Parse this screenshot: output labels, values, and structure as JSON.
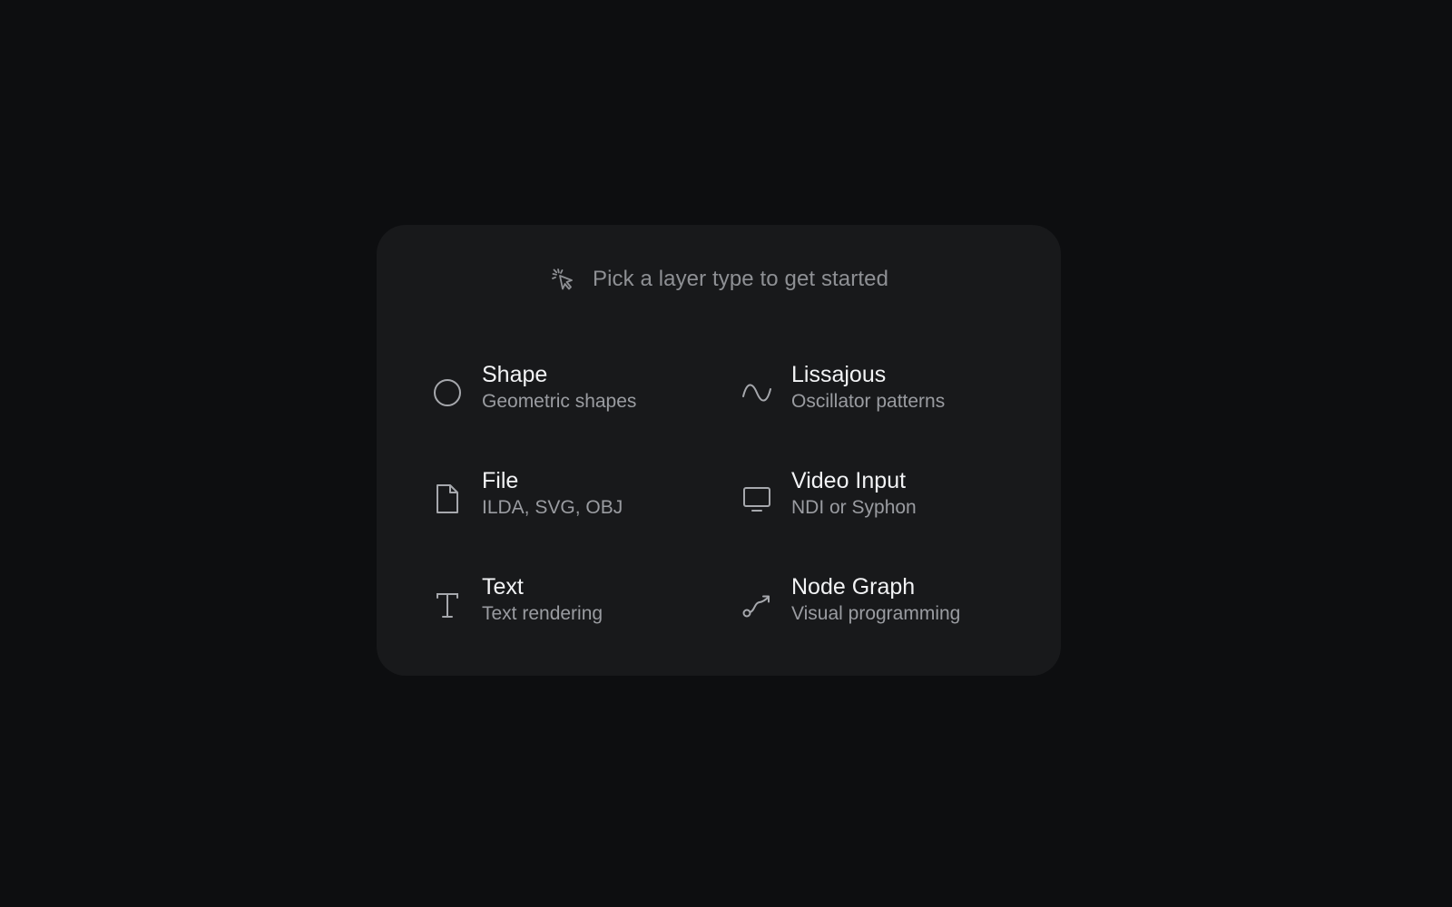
{
  "prompt": {
    "icon": "pointer-click-icon",
    "text": "Pick a layer type to get started"
  },
  "layer_types": [
    {
      "icon": "circle-icon",
      "title": "Shape",
      "subtitle": "Geometric shapes"
    },
    {
      "icon": "wave-icon",
      "title": "Lissajous",
      "subtitle": "Oscillator patterns"
    },
    {
      "icon": "file-icon",
      "title": "File",
      "subtitle": "ILDA, SVG, OBJ"
    },
    {
      "icon": "monitor-icon",
      "title": "Video Input",
      "subtitle": "NDI or Syphon"
    },
    {
      "icon": "text-icon",
      "title": "Text",
      "subtitle": "Text rendering"
    },
    {
      "icon": "node-graph-icon",
      "title": "Node Graph",
      "subtitle": "Visual programming"
    }
  ],
  "colors": {
    "background": "#0d0e10",
    "card": "#18191b",
    "title": "#f2f3f5",
    "subtitle": "#9a9ca1",
    "icon": "#a6a8ad"
  }
}
